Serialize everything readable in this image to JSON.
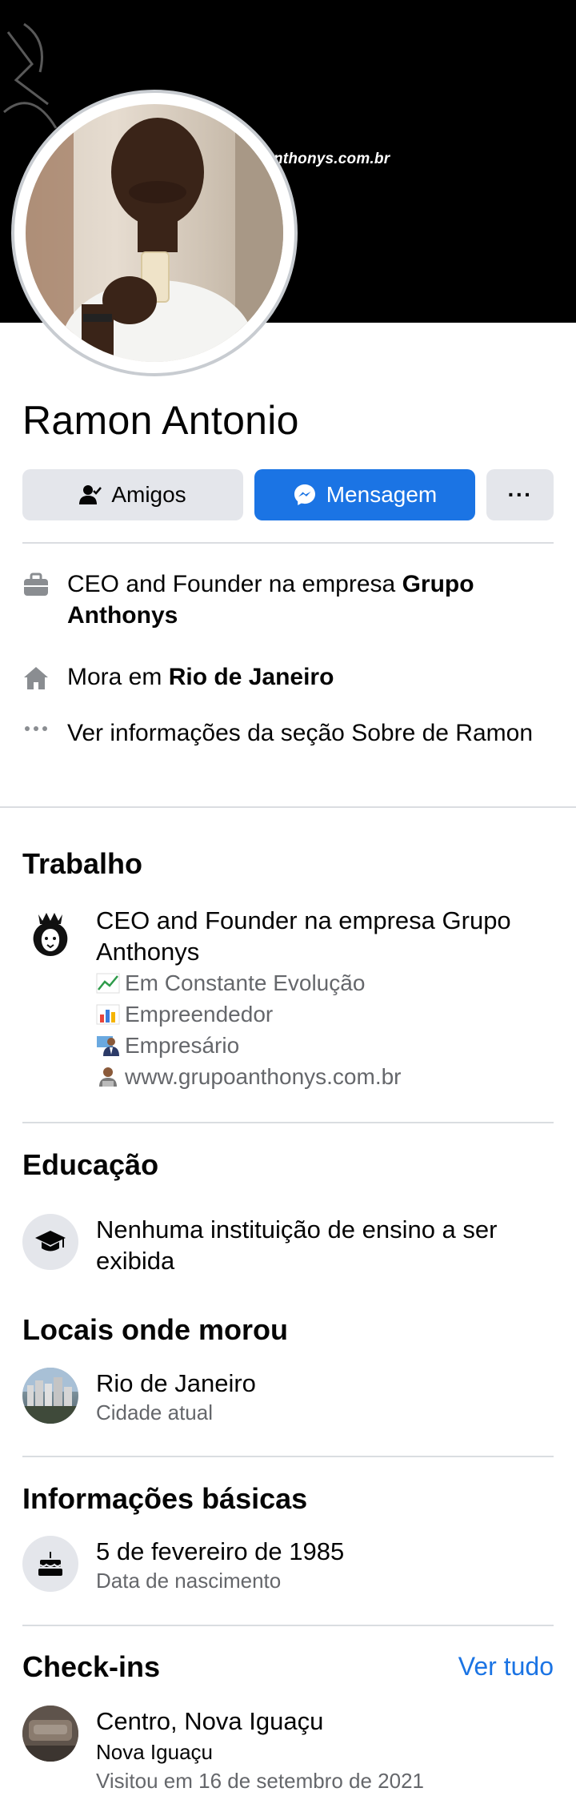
{
  "cover": {
    "text": "nthonys.com.br"
  },
  "profile": {
    "name": "Ramon Antonio"
  },
  "actions": {
    "friends": "Amigos",
    "message": "Mensagem",
    "more": "···"
  },
  "intro": {
    "work_prefix": "CEO and Founder na empresa ",
    "work_company": "Grupo Anthonys",
    "lives_prefix": "Mora em ",
    "lives_city": "Rio de Janeiro",
    "about": "Ver informações da seção Sobre de Ramon"
  },
  "work": {
    "title": "Trabalho",
    "job": "CEO and Founder na empresa Grupo Anthonys",
    "bio": [
      "Em Constante Evolução",
      "Empreendedor",
      "Empresário",
      "www.grupoanthonys.com.br"
    ]
  },
  "education": {
    "title": "Educação",
    "text": "Nenhuma instituição de ensino a ser exibida"
  },
  "places": {
    "title": "Locais onde morou",
    "city": "Rio de Janeiro",
    "label": "Cidade atual"
  },
  "basic": {
    "title": "Informações básicas",
    "birthday": "5 de fevereiro de 1985",
    "label": "Data de nascimento"
  },
  "checkins": {
    "title": "Check-ins",
    "see_all": "Ver tudo",
    "place": "Centro, Nova Iguaçu",
    "city": "Nova Iguaçu",
    "visited": "Visitou em 16 de setembro de 2021"
  },
  "colors": {
    "accent": "#1b74e4",
    "secondary_text": "#65676b",
    "button_grey": "#e4e6eb"
  }
}
